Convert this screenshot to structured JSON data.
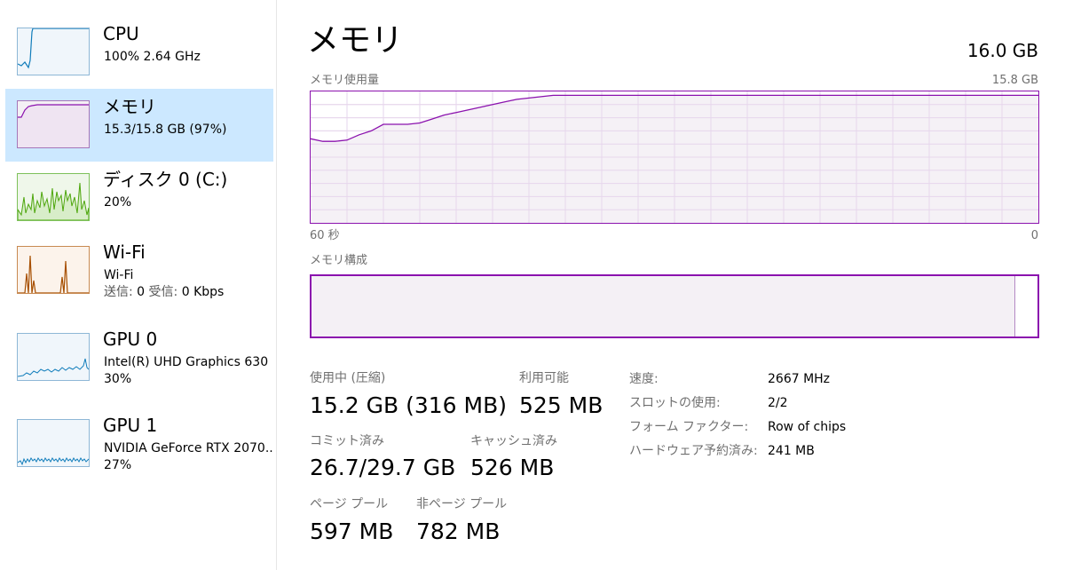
{
  "sidebar": {
    "items": [
      {
        "title": "CPU",
        "sub1": "100%  2.64 GHz",
        "color": "#117dbb",
        "fill": "#f1f6fa",
        "selected": false
      },
      {
        "title": "メモリ",
        "sub1": "15.3/15.8 GB (97%)",
        "color": "#8b12ae",
        "fill": "#f4f0f5",
        "selected": true
      },
      {
        "title": "ディスク 0 (C:)",
        "sub1": "20%",
        "color": "#4da60c",
        "fill": "#eff7ea",
        "selected": false
      },
      {
        "title": "Wi-Fi",
        "sub1": "Wi-Fi",
        "color": "#a74f01",
        "fill": "#fcf3eb",
        "selected": false,
        "sub2_send_label": "送信:",
        "sub2_send_value": "0",
        "sub2_recv_label": "受信:",
        "sub2_recv_value": "0 Kbps"
      },
      {
        "title": "GPU 0",
        "sub1": "Intel(R) UHD Graphics 630",
        "sub2": "30%",
        "color": "#117dbb",
        "fill": "#f1f6fa",
        "selected": false
      },
      {
        "title": "GPU 1",
        "sub1": "NVIDIA GeForce RTX 2070..",
        "sub2": "27%",
        "color": "#117dbb",
        "fill": "#f1f6fa",
        "selected": false
      }
    ]
  },
  "main": {
    "title": "メモリ",
    "total": "16.0 GB",
    "usage_label": "メモリ使用量",
    "usage_max": "15.8 GB",
    "time_left": "60 秒",
    "time_right": "0",
    "composition_label": "メモリ構成",
    "accent": "#8b12ae",
    "usage_percent_series": [
      64,
      62,
      62,
      63,
      67,
      70,
      75,
      75,
      75,
      76,
      79,
      82,
      84,
      86,
      88,
      90,
      92,
      94,
      95,
      96,
      97,
      97,
      97,
      97,
      97,
      97,
      97,
      97,
      97,
      97,
      97,
      97,
      97,
      97,
      97,
      97,
      97,
      97,
      97,
      97,
      97,
      97,
      97,
      97,
      97,
      97,
      97,
      97,
      97,
      97,
      97,
      97,
      97,
      97,
      97,
      97,
      97,
      97,
      97,
      97,
      97
    ],
    "composition": {
      "in_use_percent": 97
    },
    "stats": {
      "in_use": {
        "label": "使用中 (圧縮)",
        "value": "15.2 GB (316 MB)"
      },
      "available": {
        "label": "利用可能",
        "value": "525 MB"
      },
      "committed": {
        "label": "コミット済み",
        "value": "26.7/29.7 GB"
      },
      "cached": {
        "label": "キャッシュ済み",
        "value": "526 MB"
      },
      "paged_pool": {
        "label": "ページ プール",
        "value": "597 MB"
      },
      "nonpaged_pool": {
        "label": "非ページ プール",
        "value": "782 MB"
      }
    },
    "details": [
      {
        "label": "速度:",
        "value": "2667 MHz"
      },
      {
        "label": "スロットの使用:",
        "value": "2/2"
      },
      {
        "label": "フォーム ファクター:",
        "value": "Row of chips"
      },
      {
        "label": "ハードウェア予約済み:",
        "value": "241 MB"
      }
    ]
  }
}
